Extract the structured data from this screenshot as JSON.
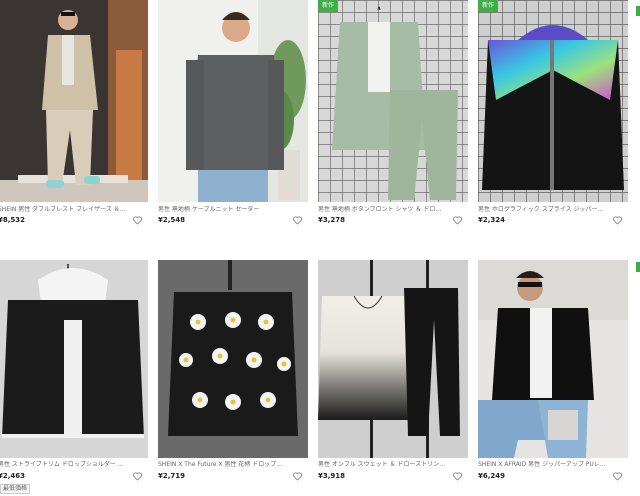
{
  "products": [
    {
      "title": "SHEIN 男性 ダブルブレスト ブレイザーズ ＆ テーラード",
      "price": "¥8,532",
      "badge": "",
      "image": "man-beige-double-breasted-suit"
    },
    {
      "title": "男性 無地柄 ケーブルニット セーター",
      "price": "¥2,548",
      "badge": "",
      "image": "man-grey-cable-knit-sweater"
    },
    {
      "title": "男性 無地柄 ボタンフロント シャツ ＆ ドローストリング パンツ",
      "price": "¥3,278",
      "badge": "新作",
      "image": "sage-green-shirt-and-pants-set"
    },
    {
      "title": "男性 ホログラフィック スプライス ジッパーアップ フード付き",
      "price": "¥2,324",
      "badge": "新作",
      "image": "black-hooded-jacket-holographic-yoke"
    },
    {
      "title": "男性 ストライプトリム ドロップショルダー ボンバー",
      "price": "¥2,463",
      "badge": "",
      "tag": "最低価格",
      "image": "black-hoodie-jacket-white-hood"
    },
    {
      "title": "SHEIN X The Future X 男性 花柄 ドロップショルダー セーター",
      "price": "¥2,719",
      "badge": "",
      "image": "black-sweater-daisy-print"
    },
    {
      "title": "男性 オンブル スウェット ＆ ドローストリング スウェットパンツ",
      "price": "¥3,918",
      "badge": "",
      "image": "ombre-sweatshirt-and-joggers-set"
    },
    {
      "title": "SHEIN X AFRAID 男性 ジッパーアップ PUレザー モト",
      "price": "¥6,249",
      "badge": "",
      "image": "man-black-leather-moto-jacket"
    }
  ],
  "colors": {
    "badge": "#3fae49",
    "price": "#222222",
    "title": "#666666"
  },
  "icons": {
    "favorite": "heart-icon"
  }
}
